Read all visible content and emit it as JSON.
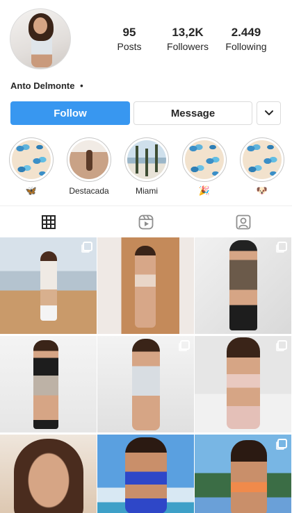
{
  "profile": {
    "username": "Anto Delmonte",
    "username_suffix": "•",
    "stats": [
      {
        "value": "95",
        "label": "Posts"
      },
      {
        "value": "13,2K",
        "label": "Followers"
      },
      {
        "value": "2.449",
        "label": "Following"
      }
    ]
  },
  "actions": {
    "follow_label": "Follow",
    "message_label": "Message",
    "more_icon": "chevron-down-icon"
  },
  "highlights": [
    {
      "label": "🦋",
      "theme": "butterfly"
    },
    {
      "label": "Destacada",
      "theme": "sauna"
    },
    {
      "label": "Miami",
      "theme": "beach"
    },
    {
      "label": "🎉",
      "theme": "butterfly"
    },
    {
      "label": "🐶",
      "theme": "butterfly"
    }
  ],
  "tabs": [
    {
      "icon": "grid-icon",
      "active": true
    },
    {
      "icon": "reels-icon",
      "active": false
    },
    {
      "icon": "tagged-icon",
      "active": false
    }
  ],
  "colors": {
    "accent": "#3897f0",
    "text": "#262626",
    "border": "#dbdbdb"
  }
}
